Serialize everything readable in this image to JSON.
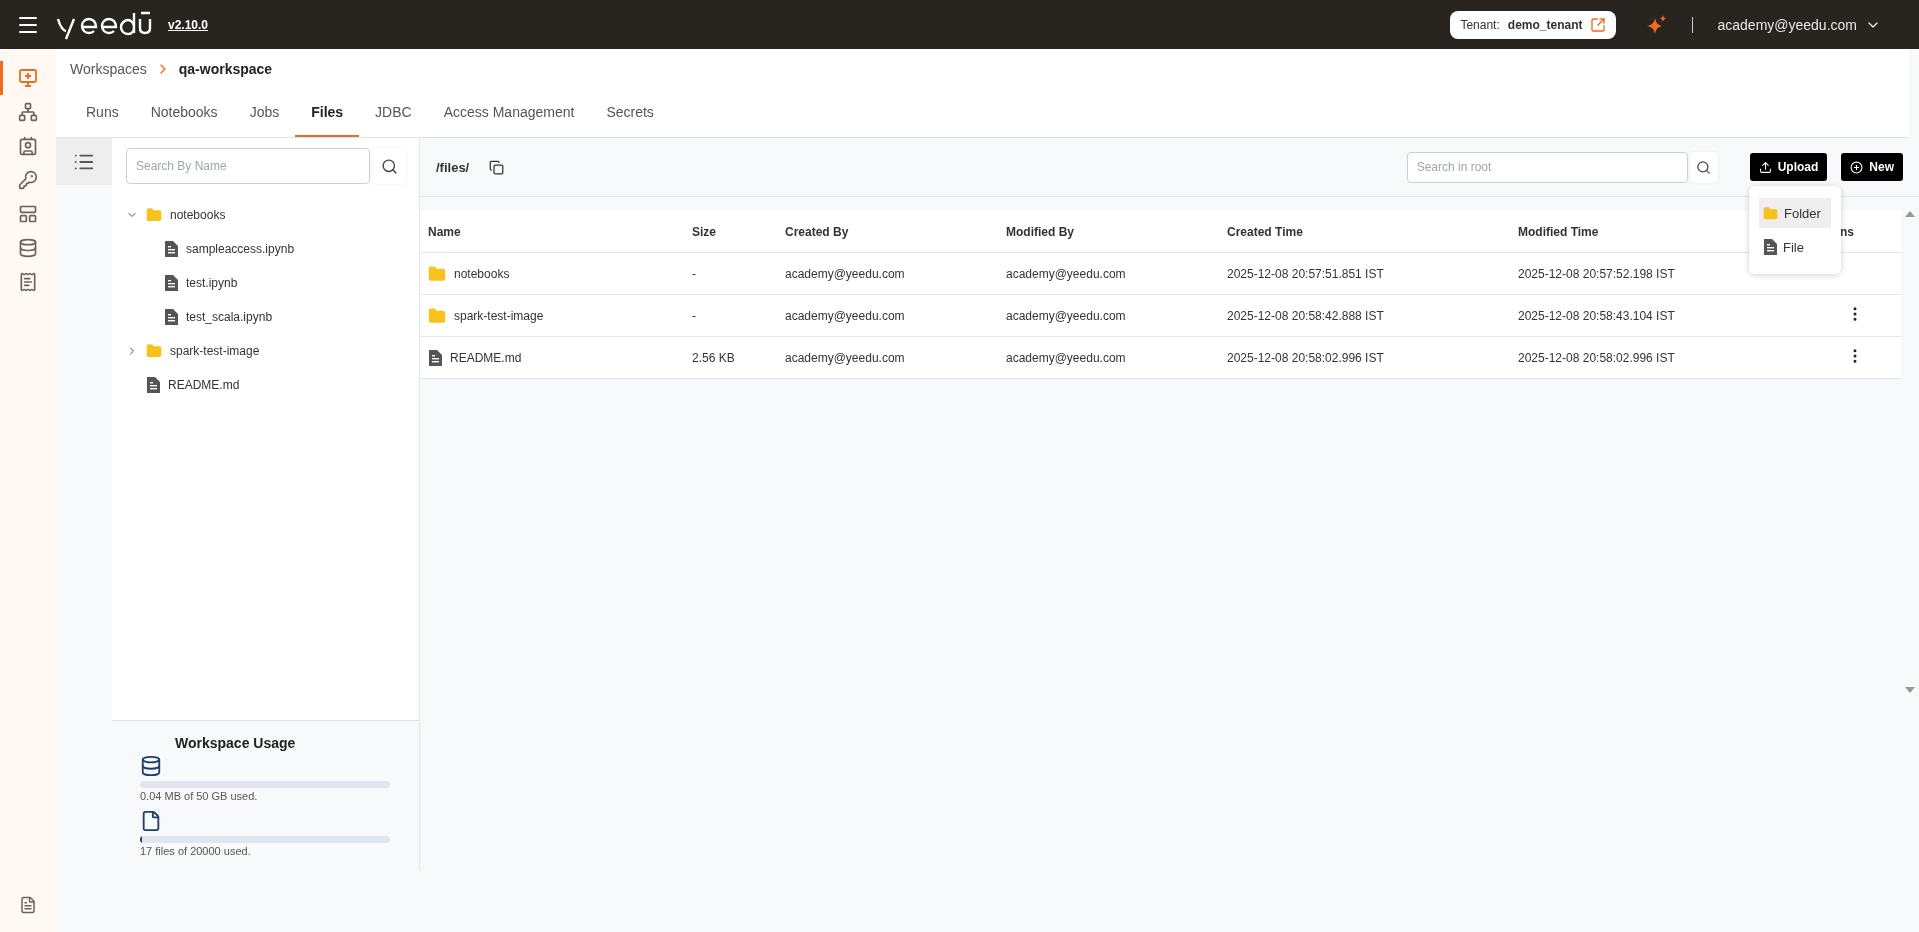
{
  "header": {
    "version": "v2.10.0",
    "tenant_label": "Tenant:",
    "tenant": "demo_tenant",
    "user": "academy@yeedu.com"
  },
  "rail": [
    {
      "selected": true
    },
    {
      "selected": false
    },
    {
      "selected": false
    },
    {
      "selected": false
    },
    {
      "selected": false
    },
    {
      "selected": false
    },
    {
      "selected": false
    }
  ],
  "breadcrumb": [
    "Workspaces",
    "qa-workspace"
  ],
  "tabs": [
    {
      "label": "Runs",
      "selected": false
    },
    {
      "label": "Notebooks",
      "selected": false
    },
    {
      "label": "Jobs",
      "selected": false
    },
    {
      "label": "Files",
      "selected": true
    },
    {
      "label": "JDBC",
      "selected": false
    },
    {
      "label": "Access Management",
      "selected": false
    },
    {
      "label": "Secrets",
      "selected": false
    }
  ],
  "tree_search": {
    "placeholder": "Search By Name"
  },
  "tree": [
    {
      "kind": "folder",
      "name": "notebooks",
      "expanded": true,
      "children": [
        {
          "kind": "file",
          "name": "sampleaccess.ipynb"
        },
        {
          "kind": "file",
          "name": "test.ipynb"
        },
        {
          "kind": "file",
          "name": "test_scala.ipynb"
        }
      ]
    },
    {
      "kind": "folder",
      "name": "spark-test-image",
      "expanded": false
    },
    {
      "kind": "file",
      "name": "README.md"
    }
  ],
  "usage": {
    "title": "Workspace Usage",
    "meters": [
      {
        "kind": "storage",
        "level": 0,
        "reading": "0.04 MB of 50 GB used."
      },
      {
        "kind": "files",
        "level": 0.002,
        "reading": "17 files of 20000 used."
      }
    ]
  },
  "path": "/files/",
  "search": {
    "placeholder": "Search in root"
  },
  "buttons": [
    {
      "kind": "upload",
      "label": "Upload"
    },
    {
      "kind": "new",
      "label": "New"
    }
  ],
  "upload_menu": [
    {
      "kind": "folder",
      "label": "Folder",
      "selected": true
    },
    {
      "kind": "file",
      "label": "File",
      "selected": false
    }
  ],
  "table": {
    "columns": [
      "Name",
      "Size",
      "Created By",
      "Modified By",
      "Created Time",
      "Modified Time",
      "ns"
    ],
    "rows": [
      {
        "kind": "folder",
        "cells": [
          "notebooks",
          "-",
          "academy@yeedu.com",
          "academy@yeedu.com",
          "2025-12-08 20:57:51.851 IST",
          "2025-12-08 20:57:52.198 IST"
        ],
        "has_menu": false
      },
      {
        "kind": "folder",
        "cells": [
          "spark-test-image",
          "-",
          "academy@yeedu.com",
          "academy@yeedu.com",
          "2025-12-08 20:58:42.888 IST",
          "2025-12-08 20:58:43.104 IST"
        ],
        "has_menu": true
      },
      {
        "kind": "file",
        "cells": [
          "README.md",
          "2.56 KB",
          "academy@yeedu.com",
          "academy@yeedu.com",
          "2025-12-08 20:58:02.996 IST",
          "2025-12-08 20:58:02.996 IST"
        ],
        "has_menu": true
      }
    ]
  }
}
